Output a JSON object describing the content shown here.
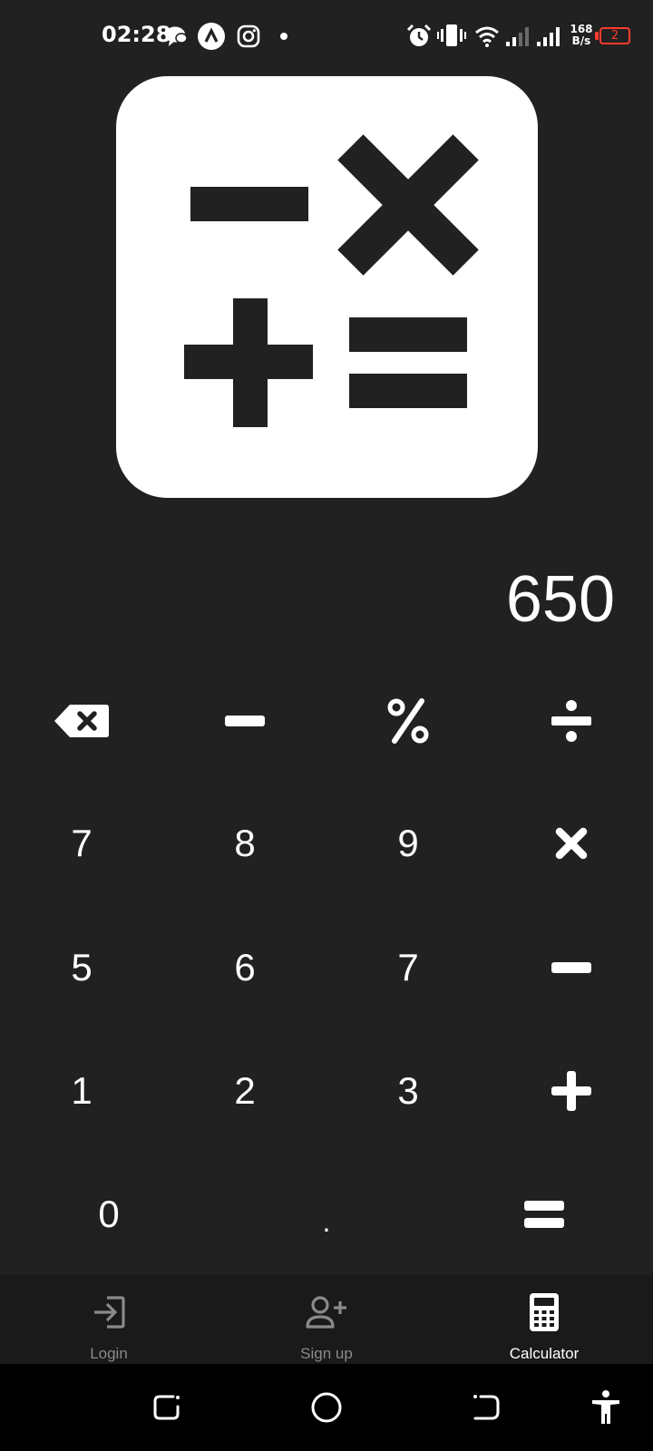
{
  "status_bar": {
    "time": "02:28",
    "net_speed_value": "168",
    "net_speed_unit": "B/s",
    "battery_level": "2",
    "icons": [
      "chat-bubble-icon",
      "app-a-icon",
      "instagram-icon",
      "dot-icon",
      "alarm-icon",
      "vibrate-icon",
      "wifi-icon",
      "signal-1-icon",
      "signal-2-icon",
      "battery-icon"
    ]
  },
  "logo": {
    "icon": "calculator-logo-icon"
  },
  "display": {
    "value": "650"
  },
  "keypad": {
    "row1": [
      "backspace-icon",
      "minus-icon",
      "percent-icon",
      "divide-icon"
    ],
    "row2": [
      "7",
      "8",
      "9",
      "multiply-icon"
    ],
    "row3": [
      "5",
      "6",
      "7",
      "minus-icon"
    ],
    "row4": [
      "1",
      "2",
      "3",
      "plus-icon"
    ],
    "row5": [
      "0",
      ".",
      "equals-icon"
    ]
  },
  "bottom_nav": {
    "items": [
      {
        "label": "Login",
        "icon": "login-icon",
        "active": false
      },
      {
        "label": "Sign up",
        "icon": "add-user-icon",
        "active": false
      },
      {
        "label": "Calculator",
        "icon": "calculator-icon",
        "active": true
      }
    ]
  },
  "colors": {
    "background": "#212121",
    "nav_background": "#1a1a1a",
    "system_nav": "#000000",
    "text": "#ffffff",
    "inactive": "#8a8a8a",
    "battery_low": "#ff3b30"
  }
}
